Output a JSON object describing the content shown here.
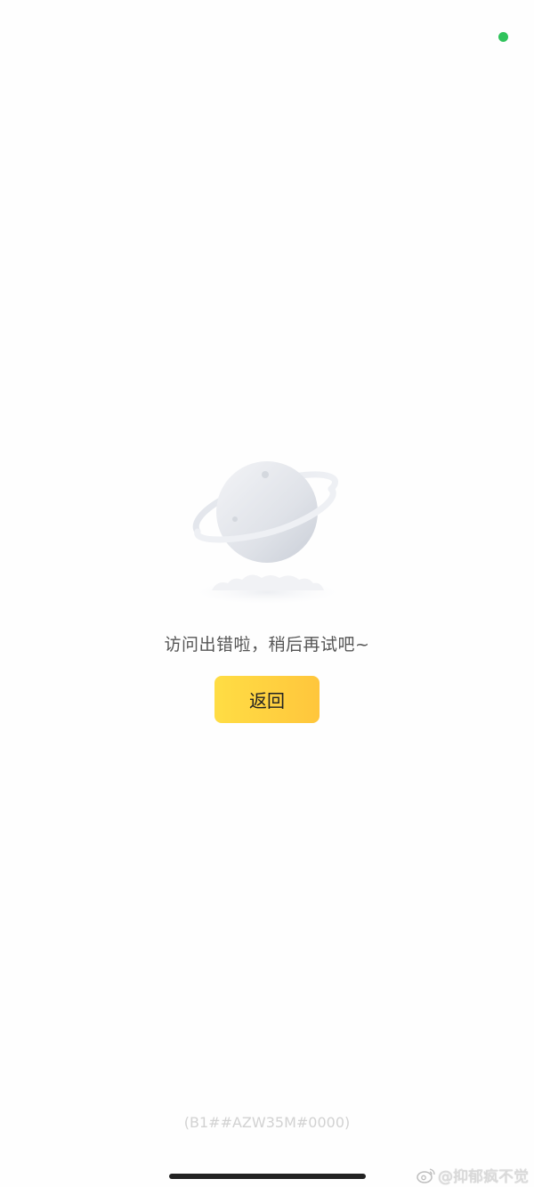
{
  "status": {
    "indicator_color": "#2fc35b"
  },
  "error": {
    "illustration_icon": "planet-icon",
    "message": "访问出错啦，稍后再试吧~",
    "back_label": "返回",
    "code": "(B1##AZW35M#0000)"
  },
  "colors": {
    "button_gradient_start": "#ffdd44",
    "button_gradient_end": "#ffc63c",
    "message_text": "#555555",
    "code_text": "#d2d2d2"
  },
  "watermark": {
    "icon": "weibo-logo-icon",
    "text": "@抑郁疯不觉"
  }
}
